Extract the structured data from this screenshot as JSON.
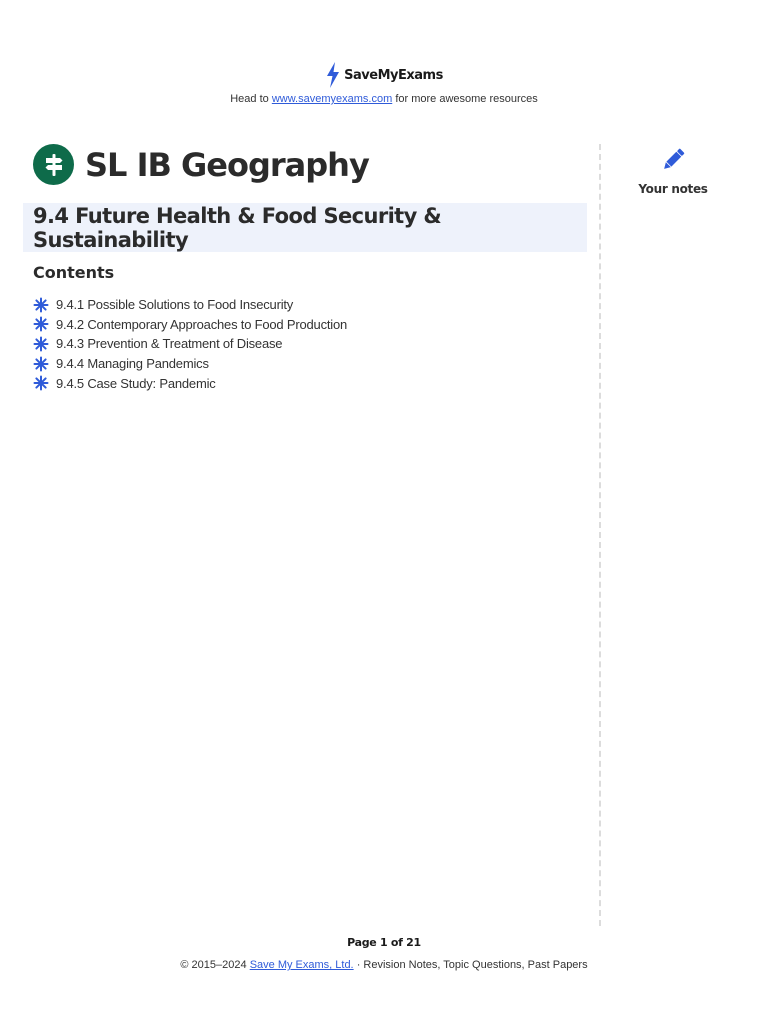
{
  "header": {
    "brand": "SaveMyExams",
    "tagline_prefix": "Head to",
    "tagline_link": "www.savemyexams.com",
    "tagline_suffix": "for more awesome resources",
    "logo_icon": "lightning-bolt-icon",
    "accent_color": "#2f5bd9"
  },
  "document": {
    "subject_icon": "signpost-icon",
    "subject_color": "#0e6b4a",
    "subject_title": "SL IB Geography",
    "topic_title": "9.4 Future Health & Food Security & Sustainability",
    "contents_heading": "Contents",
    "contents": [
      "9.4.1 Possible Solutions to Food Insecurity",
      "9.4.2 Contemporary Approaches to Food Production",
      "9.4.3 Prevention & Treatment of Disease",
      "9.4.4 Managing Pandemics",
      "9.4.5 Case Study: Pandemic"
    ],
    "bullet_icon": "asterisk-star-icon"
  },
  "sidebar": {
    "notes_icon": "pencil-icon",
    "notes_label": "Your notes"
  },
  "footer": {
    "page_label": "Page 1 of 21",
    "copyright_prefix": "© 2015–2024",
    "copyright_link": "Save My Exams, Ltd.",
    "copyright_suffix": "· Revision Notes, Topic Questions, Past Papers"
  }
}
